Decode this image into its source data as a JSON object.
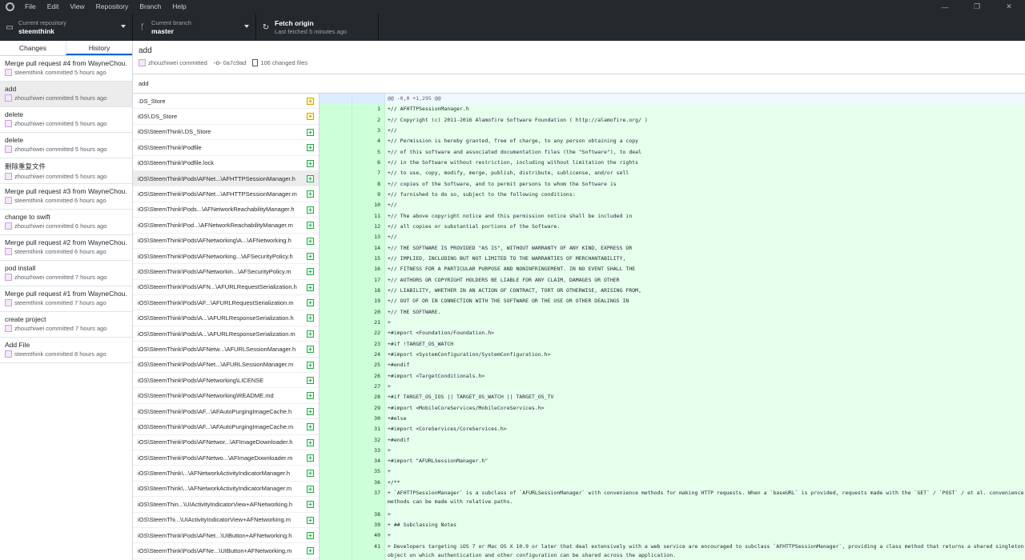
{
  "menu": [
    "File",
    "Edit",
    "View",
    "Repository",
    "Branch",
    "Help"
  ],
  "window_controls": [
    "—",
    "❐",
    "✕"
  ],
  "toolbar": {
    "repo_label": "Current repository",
    "repo_value": "steemthink",
    "branch_label": "Current branch",
    "branch_value": "master",
    "fetch_title": "Fetch origin",
    "fetch_sub": "Last fetched 5 minutes ago"
  },
  "tabs": {
    "changes": "Changes",
    "history": "History"
  },
  "commits": [
    {
      "title": "Merge pull request #4 from WayneChou…",
      "meta": "steemthink committed 5 hours ago"
    },
    {
      "title": "add",
      "meta": "zhouzhiwei committed 5 hours ago"
    },
    {
      "title": "delete",
      "meta": "zhouzhiwei committed 5 hours ago"
    },
    {
      "title": "delete",
      "meta": "zhouzhiwei committed 5 hours ago"
    },
    {
      "title": "删除重复文件",
      "meta": "zhouzhiwei committed 5 hours ago"
    },
    {
      "title": "Merge pull request #3 from WayneChou…",
      "meta": "steemthink committed 6 hours ago"
    },
    {
      "title": "change to swift",
      "meta": "zhouzhiwei committed 6 hours ago"
    },
    {
      "title": "Merge pull request #2 from WayneChou…",
      "meta": "steemthink committed 6 hours ago"
    },
    {
      "title": "pod install",
      "meta": "zhouzhiwei committed 7 hours ago"
    },
    {
      "title": "Merge pull request #1 from WayneChou…",
      "meta": "steemthink committed 7 hours ago"
    },
    {
      "title": "create project",
      "meta": "zhouzhiwei committed 7 hours ago"
    },
    {
      "title": "Add File",
      "meta": "steemthink committed 8 hours ago"
    }
  ],
  "commit": {
    "summary": "add",
    "author": "zhouzhiwei committed",
    "sha": "0a7c9ad",
    "changed": "106 changed files",
    "description": "add"
  },
  "files": [
    {
      "path": ".DS_Store",
      "status": "modified"
    },
    {
      "path": "iOS\\.DS_Store",
      "status": "modified"
    },
    {
      "path": "iOS\\SteemThink\\.DS_Store",
      "status": "added"
    },
    {
      "path": "iOS\\SteemThink\\Podfile",
      "status": "added"
    },
    {
      "path": "iOS\\SteemThink\\Podfile.lock",
      "status": "added"
    },
    {
      "path": "iOS\\SteemThink\\Pods\\AFNet...\\AFHTTPSessionManager.h",
      "status": "added"
    },
    {
      "path": "iOS\\SteemThink\\Pods\\AFNet...\\AFHTTPSessionManager.m",
      "status": "added"
    },
    {
      "path": "iOS\\SteemThink\\Pods...\\AFNetworkReachabilityManager.h",
      "status": "added"
    },
    {
      "path": "iOS\\SteemThink\\Pod...\\AFNetworkReachabilityManager.m",
      "status": "added"
    },
    {
      "path": "iOS\\SteemThink\\Pods\\AFNetworking\\A...\\AFNetworking.h",
      "status": "added"
    },
    {
      "path": "iOS\\SteemThink\\Pods\\AFNetworking...\\AFSecurityPolicy.h",
      "status": "added"
    },
    {
      "path": "iOS\\SteemThink\\Pods\\AFNetworkin...\\AFSecurityPolicy.m",
      "status": "added"
    },
    {
      "path": "iOS\\SteemThink\\Pods\\AFN...\\AFURLRequestSerialization.h",
      "status": "added"
    },
    {
      "path": "iOS\\SteemThink\\Pods\\AF...\\AFURLRequestSerialization.m",
      "status": "added"
    },
    {
      "path": "iOS\\SteemThink\\Pods\\A...\\AFURLResponseSerialization.h",
      "status": "added"
    },
    {
      "path": "iOS\\SteemThink\\Pods\\A...\\AFURLResponseSerialization.m",
      "status": "added"
    },
    {
      "path": "iOS\\SteemThink\\Pods\\AFNetw...\\AFURLSessionManager.h",
      "status": "added"
    },
    {
      "path": "iOS\\SteemThink\\Pods\\AFNet...\\AFURLSessionManager.m",
      "status": "added"
    },
    {
      "path": "iOS\\SteemThink\\Pods\\AFNetworking\\LICENSE",
      "status": "added"
    },
    {
      "path": "iOS\\SteemThink\\Pods\\AFNetworking\\README.md",
      "status": "added"
    },
    {
      "path": "iOS\\SteemThink\\Pods\\AF...\\AFAutoPurgingImageCache.h",
      "status": "added"
    },
    {
      "path": "iOS\\SteemThink\\Pods\\AF...\\AFAutoPurgingImageCache.m",
      "status": "added"
    },
    {
      "path": "iOS\\SteemThink\\Pods\\AFNetwor...\\AFImageDownloader.h",
      "status": "added"
    },
    {
      "path": "iOS\\SteemThink\\Pods\\AFNetwo...\\AFImageDownloader.m",
      "status": "added"
    },
    {
      "path": "iOS\\SteemThink\\...\\AFNetworkActivityIndicatorManager.h",
      "status": "added"
    },
    {
      "path": "iOS\\SteemThink\\...\\AFNetworkActivityIndicatorManager.m",
      "status": "added"
    },
    {
      "path": "iOS\\SteemThin...\\UIActivityIndicatorView+AFNetworking.h",
      "status": "added"
    },
    {
      "path": "iOS\\SteemThi...\\UIActivityIndicatorView+AFNetworking.m",
      "status": "added"
    },
    {
      "path": "iOS\\SteemThink\\Pods\\AFNet...\\UIButton+AFNetworking.h",
      "status": "added"
    },
    {
      "path": "iOS\\SteemThink\\Pods\\AFNe...\\UIButton+AFNetworking.m",
      "status": "added"
    }
  ],
  "diff": {
    "hunk": "@@ -0,0 +1,295 @@",
    "lines": [
      {
        "n": "1",
        "code": "+// AFHTTPSessionManager.h"
      },
      {
        "n": "2",
        "code": "+// Copyright (c) 2011-2016 Alamofire Software Foundation ( http://alamofire.org/ )"
      },
      {
        "n": "3",
        "code": "+//"
      },
      {
        "n": "4",
        "code": "+// Permission is hereby granted, free of charge, to any person obtaining a copy"
      },
      {
        "n": "5",
        "code": "+// of this software and associated documentation files (the \"Software\"), to deal"
      },
      {
        "n": "6",
        "code": "+// in the Software without restriction, including without limitation the rights"
      },
      {
        "n": "7",
        "code": "+// to use, copy, modify, merge, publish, distribute, sublicense, and/or sell"
      },
      {
        "n": "8",
        "code": "+// copies of the Software, and to permit persons to whom the Software is"
      },
      {
        "n": "9",
        "code": "+// furnished to do so, subject to the following conditions:"
      },
      {
        "n": "10",
        "code": "+//"
      },
      {
        "n": "11",
        "code": "+// The above copyright notice and this permission notice shall be included in"
      },
      {
        "n": "12",
        "code": "+// all copies or substantial portions of the Software."
      },
      {
        "n": "13",
        "code": "+//"
      },
      {
        "n": "14",
        "code": "+// THE SOFTWARE IS PROVIDED \"AS IS\", WITHOUT WARRANTY OF ANY KIND, EXPRESS OR"
      },
      {
        "n": "15",
        "code": "+// IMPLIED, INCLUDING BUT NOT LIMITED TO THE WARRANTIES OF MERCHANTABILITY,"
      },
      {
        "n": "16",
        "code": "+// FITNESS FOR A PARTICULAR PURPOSE AND NONINFRINGEMENT. IN NO EVENT SHALL THE"
      },
      {
        "n": "17",
        "code": "+// AUTHORS OR COPYRIGHT HOLDERS BE LIABLE FOR ANY CLAIM, DAMAGES OR OTHER"
      },
      {
        "n": "18",
        "code": "+// LIABILITY, WHETHER IN AN ACTION OF CONTRACT, TORT OR OTHERWISE, ARISING FROM,"
      },
      {
        "n": "19",
        "code": "+// OUT OF OR IN CONNECTION WITH THE SOFTWARE OR THE USE OR OTHER DEALINGS IN"
      },
      {
        "n": "20",
        "code": "+// THE SOFTWARE."
      },
      {
        "n": "21",
        "code": "+"
      },
      {
        "n": "22",
        "code": "+#import <Foundation/Foundation.h>"
      },
      {
        "n": "23",
        "code": "+#if !TARGET_OS_WATCH"
      },
      {
        "n": "24",
        "code": "+#import <SystemConfiguration/SystemConfiguration.h>"
      },
      {
        "n": "25",
        "code": "+#endif"
      },
      {
        "n": "26",
        "code": "+#import <TargetConditionals.h>"
      },
      {
        "n": "27",
        "code": "+"
      },
      {
        "n": "28",
        "code": "+#if TARGET_OS_IOS || TARGET_OS_WATCH || TARGET_OS_TV"
      },
      {
        "n": "29",
        "code": "+#import <MobileCoreServices/MobileCoreServices.h>"
      },
      {
        "n": "30",
        "code": "+#else"
      },
      {
        "n": "31",
        "code": "+#import <CoreServices/CoreServices.h>"
      },
      {
        "n": "32",
        "code": "+#endif"
      },
      {
        "n": "33",
        "code": "+"
      },
      {
        "n": "34",
        "code": "+#import \"AFURLSessionManager.h\""
      },
      {
        "n": "35",
        "code": "+"
      },
      {
        "n": "36",
        "code": "+/**"
      },
      {
        "n": "37",
        "code": "+ `AFHTTPSessionManager` is a subclass of `AFURLSessionManager` with convenience methods for making HTTP requests. When a `baseURL` is provided, requests made with the `GET` / `POST` / et al. convenience methods can be made with relative paths.",
        "wrap": true
      },
      {
        "n": "38",
        "code": "+"
      },
      {
        "n": "39",
        "code": "+ ## Subclassing Notes"
      },
      {
        "n": "40",
        "code": "+"
      },
      {
        "n": "41",
        "code": "+ Developers targeting iOS 7 or Mac OS X 10.9 or later that deal extensively with a web service are encouraged to subclass `AFHTTPSessionManager`, providing a class method that returns a shared singleton object on which authentication and other configuration can be shared across the application.",
        "wrap": true
      }
    ]
  }
}
